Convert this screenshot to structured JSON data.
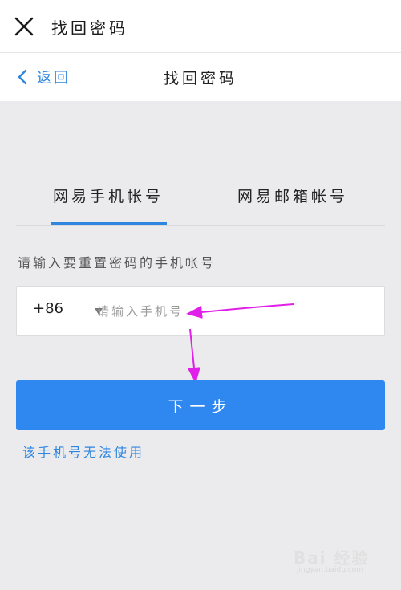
{
  "header": {
    "title": "找回密码",
    "close_icon": "close-icon"
  },
  "nav": {
    "back_label": "返回",
    "title": "找回密码"
  },
  "tabs": [
    {
      "label": "网易手机帐号",
      "active": true
    },
    {
      "label": "网易邮箱帐号",
      "active": false
    }
  ],
  "form": {
    "hint": "请输入要重置密码的手机帐号",
    "country_code": "+86",
    "phone_placeholder": "请输入手机号",
    "phone_value": "",
    "next_label": "下一步",
    "alt_link": "该手机号无法使用"
  },
  "watermark": {
    "text": "Bai 经验",
    "sub": "jingyan.baidu.com"
  },
  "colors": {
    "accent": "#2e86e0",
    "button": "#2f87f0",
    "background": "#ebebed",
    "annotation_arrow": "#e020e8"
  }
}
